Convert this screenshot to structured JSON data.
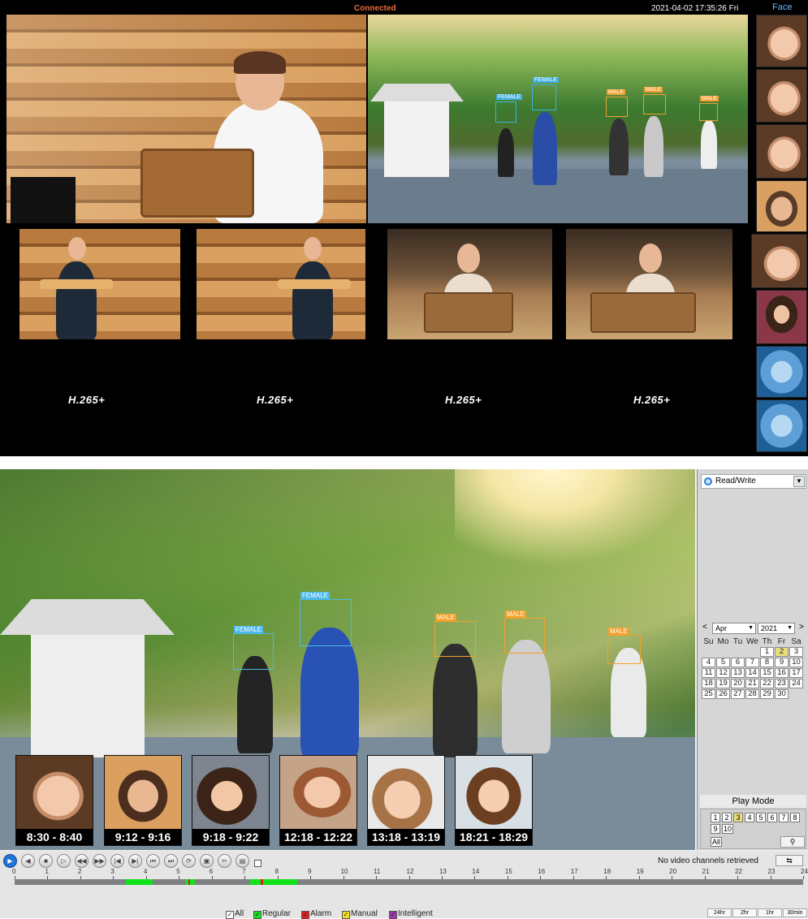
{
  "top": {
    "status": "Connected",
    "datetime": "2021-04-02 17:35:26 Fri",
    "face_panel_title": "Face",
    "codec_labels": [
      "H.265+",
      "H.265+",
      "H.265+",
      "H.265+"
    ],
    "detections": [
      "FEMALE",
      "FEMALE",
      "MALE",
      "MALE",
      "MALE"
    ]
  },
  "playback": {
    "detections": [
      "FEMALE",
      "FEMALE",
      "MALE",
      "MALE",
      "MALE"
    ],
    "face_clips": [
      "8:30 - 8:40",
      "9:12 - 9:16",
      "9:18 - 9:22",
      "12:18 - 12:22",
      "13:18 - 13:19",
      "18:21 - 18:29"
    ],
    "rw_select": "Read/Write",
    "calendar": {
      "month": "Apr",
      "year": "2021",
      "prev": "<",
      "next": ">",
      "weekdays": [
        "Su",
        "Mo",
        "Tu",
        "We",
        "Th",
        "Fr",
        "Sa"
      ],
      "selected_day": "2"
    },
    "play_mode": {
      "title": "Play Mode",
      "channels": [
        "1",
        "2",
        "3",
        "4",
        "5",
        "6",
        "7",
        "8",
        "9",
        "10"
      ],
      "selected_channel": "3",
      "all_label": "All"
    },
    "status": "No video channels retrieved",
    "hours": [
      "0",
      "1",
      "2",
      "3",
      "4",
      "5",
      "6",
      "7",
      "8",
      "9",
      "10",
      "11",
      "12",
      "13",
      "14",
      "15",
      "16",
      "17",
      "18",
      "19",
      "20",
      "21",
      "22",
      "23",
      "24"
    ],
    "legend": [
      "All",
      "Regular",
      "Alarm",
      "Manual",
      "Intelligent"
    ],
    "legend_colors": [
      "#ffffff",
      "#12e21a",
      "#e01b1b",
      "#f0e020",
      "#9b3aa8"
    ],
    "zoom": [
      "24hr",
      "2hr",
      "1hr",
      "30min"
    ]
  }
}
